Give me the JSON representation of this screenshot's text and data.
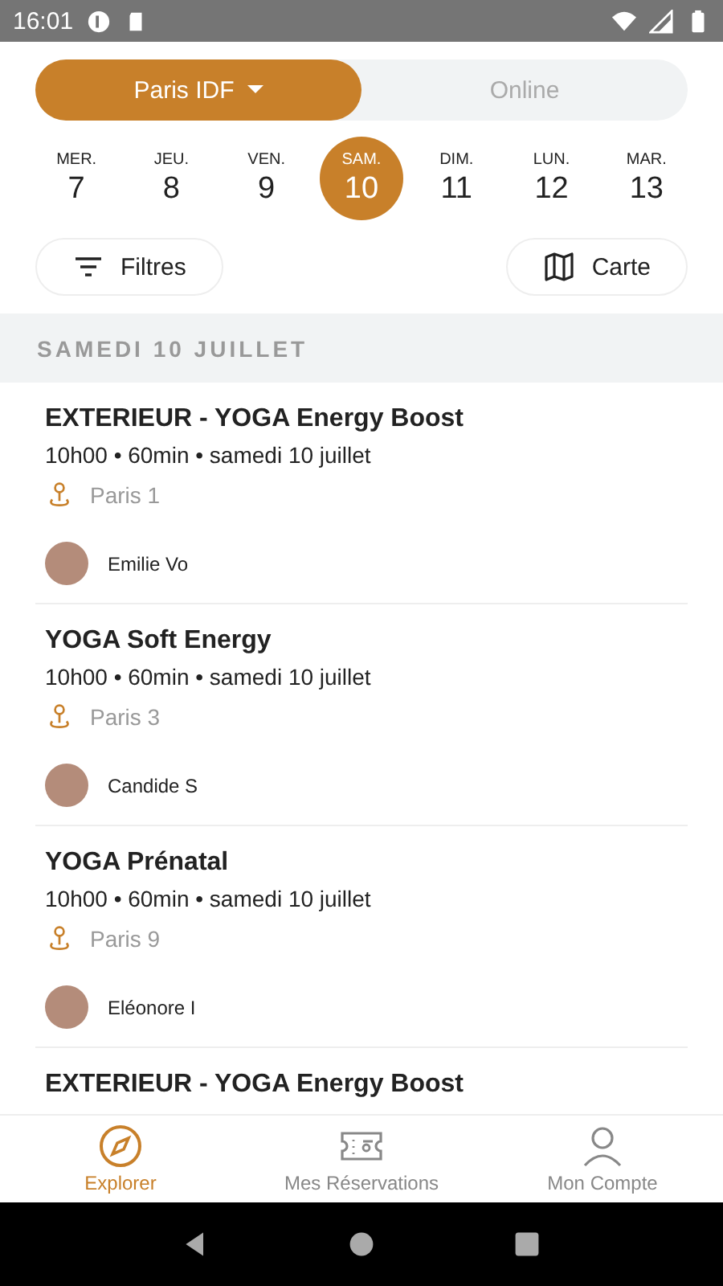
{
  "status_bar": {
    "time": "16:01"
  },
  "segments": [
    {
      "label": "Paris IDF",
      "selected": true,
      "dropdown": true
    },
    {
      "label": "Online",
      "selected": false,
      "dropdown": false
    }
  ],
  "days": [
    {
      "weekday": "MER.",
      "day": "7",
      "selected": false
    },
    {
      "weekday": "JEU.",
      "day": "8",
      "selected": false
    },
    {
      "weekday": "VEN.",
      "day": "9",
      "selected": false
    },
    {
      "weekday": "SAM.",
      "day": "10",
      "selected": true
    },
    {
      "weekday": "DIM.",
      "day": "11",
      "selected": false
    },
    {
      "weekday": "LUN.",
      "day": "12",
      "selected": false
    },
    {
      "weekday": "MAR.",
      "day": "13",
      "selected": false
    }
  ],
  "filters_button": "Filtres",
  "map_button": "Carte",
  "section_header": "SAMEDI 10 JUILLET",
  "classes": [
    {
      "title": "EXTERIEUR - YOGA Energy Boost",
      "details": "10h00 • 60min • samedi 10 juillet",
      "location": "Paris 1",
      "teacher": "Emilie Vo"
    },
    {
      "title": "YOGA Soft Energy",
      "details": "10h00 • 60min • samedi 10 juillet",
      "location": "Paris 3",
      "teacher": "Candide S"
    },
    {
      "title": "YOGA Prénatal",
      "details": "10h00 • 60min • samedi 10 juillet",
      "location": "Paris 9",
      "teacher": "Eléonore I"
    },
    {
      "title": "EXTERIEUR - YOGA Energy Boost"
    }
  ],
  "bottom_nav": [
    {
      "label": "Explorer",
      "kind": "compass",
      "selected": true
    },
    {
      "label": "Mes Réservations",
      "kind": "ticket",
      "selected": false
    },
    {
      "label": "Mon Compte",
      "kind": "person",
      "selected": false
    }
  ]
}
